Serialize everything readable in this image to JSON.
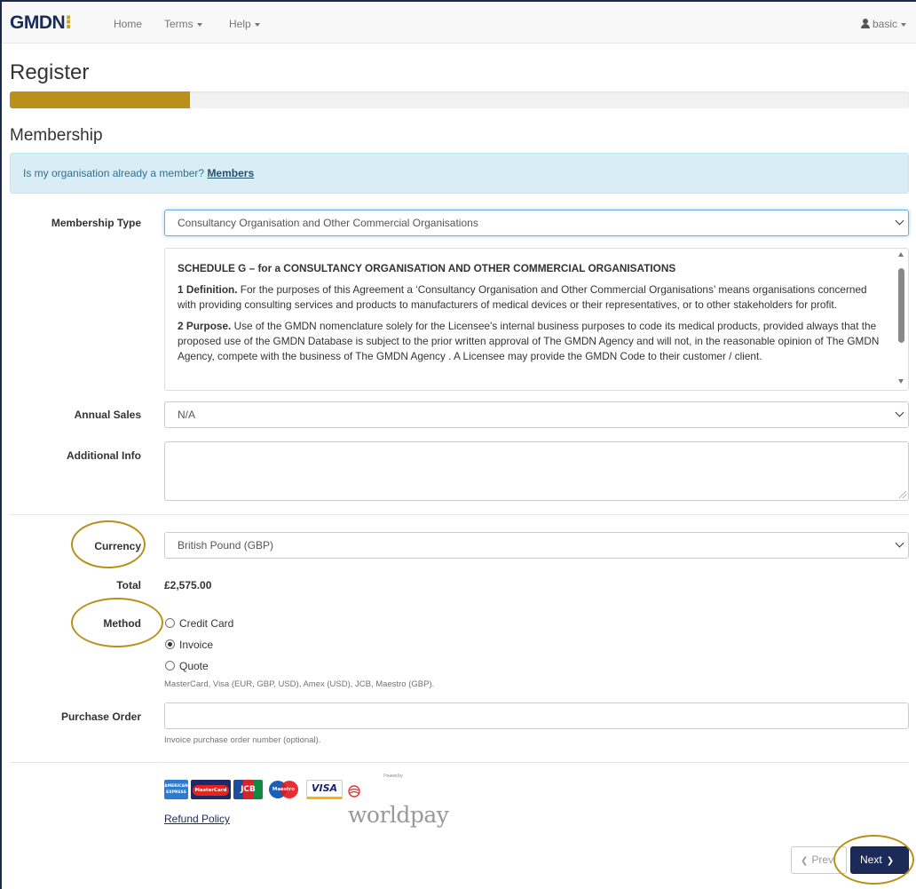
{
  "navbar": {
    "brand_main": "GMDN",
    "brand_accent": "⁝",
    "links": {
      "home": "Home",
      "terms": "Terms",
      "help": "Help"
    },
    "user": "basic"
  },
  "page": {
    "title": "Register",
    "progress_fraction": 0.2
  },
  "membership": {
    "heading": "Membership",
    "alert_text": "Is my organisation already a member?",
    "alert_link": "Members",
    "type_label": "Membership Type",
    "type_value": "Consultancy Organisation and Other Commercial Organisations",
    "schedule": {
      "heading": "SCHEDULE G – for a CONSULTANCY ORGANISATION AND OTHER COMMERCIAL ORGANISATIONS",
      "p1_term": "1 Definition.",
      "p1_text": " For the purposes of this Agreement a ‘Consultancy Organisation and Other Commercial Organisations’ means organisations concerned with providing consulting services and products to manufacturers of medical devices or their representatives, or to other stakeholders for profit.",
      "p2_term": "2 Purpose.",
      "p2_text": " Use of the GMDN nomenclature solely for the Licensee's internal business purposes to code its medical products, provided always that the proposed use of the GMDN Database is subject to the prior written approval of The GMDN Agency and will not, in the reasonable opinion of The GMDN Agency, compete with the business of The GMDN Agency . A Licensee may provide the GMDN Code to their customer / client."
    },
    "sales_label": "Annual Sales",
    "sales_value": "N/A",
    "info_label": "Additional Info"
  },
  "payment": {
    "currency_label": "Currency",
    "currency_value": "British Pound (GBP)",
    "total_label": "Total",
    "total_value": "£2,575.00",
    "method_label": "Method",
    "methods": [
      "Credit Card",
      "Invoice",
      "Quote"
    ],
    "selected_method": "Invoice",
    "cards_help": "MasterCard, Visa (EUR, GBP, USD), Amex (USD), JCB, Maestro (GBP).",
    "po_label": "Purchase Order",
    "po_help": "Invoice purchase order number (optional).",
    "card_logos": [
      "AMERICAN EXPRESS",
      "MasterCard",
      "JCB",
      "Maestro",
      "VISA"
    ],
    "worldpay": "worldpay",
    "worldpay_tag": "Powered by",
    "refund_link": "Refund Policy"
  },
  "buttons": {
    "prev": "Prev",
    "next": "Next"
  },
  "colors": {
    "brand_navy": "#1b2a56",
    "brand_gold": "#b8901a",
    "alert_bg": "#d9edf7"
  }
}
